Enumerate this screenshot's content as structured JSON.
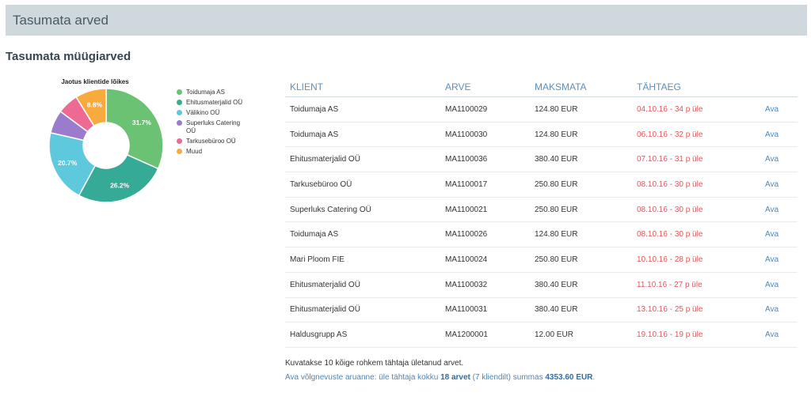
{
  "page": {
    "title": "Tasumata arved"
  },
  "section": {
    "title": "Tasumata müügiarved"
  },
  "chart_data": {
    "type": "pie",
    "title": "Jaotus klientide lõikes",
    "categories": [
      "Toidumaja AS",
      "Ehitusmaterjalid OÜ",
      "Välikino OÜ",
      "Superluks Catering OÜ",
      "Tarkusebüroo OÜ",
      "Muud"
    ],
    "values": [
      31.7,
      26.2,
      20.7,
      6.6,
      6.0,
      8.8
    ],
    "labels": [
      "31.7%",
      "26.2%",
      "20.7%",
      "",
      "",
      "8.8%"
    ],
    "colors": [
      "#6ac272",
      "#35ab97",
      "#5ec9dc",
      "#9b7ccc",
      "#ec6a93",
      "#f9aa3c"
    ],
    "legend_position": "right"
  },
  "table": {
    "headers": [
      "KLIENT",
      "ARVE",
      "MAKSMATA",
      "TÄHTAEG",
      ""
    ],
    "rows": [
      {
        "client": "Toidumaja AS",
        "invoice": "MA1100029",
        "amount": "124.80 EUR",
        "due": "04.10.16 - 34 p üle",
        "action": "Ava"
      },
      {
        "client": "Toidumaja AS",
        "invoice": "MA1100030",
        "amount": "124.80 EUR",
        "due": "06.10.16 - 32 p üle",
        "action": "Ava"
      },
      {
        "client": "Ehitusmaterjalid OÜ",
        "invoice": "MA1100036",
        "amount": "380.40 EUR",
        "due": "07.10.16 - 31 p üle",
        "action": "Ava"
      },
      {
        "client": "Tarkusebüroo OÜ",
        "invoice": "MA1100017",
        "amount": "250.80 EUR",
        "due": "08.10.16 - 30 p üle",
        "action": "Ava"
      },
      {
        "client": "Superluks Catering OÜ",
        "invoice": "MA1100021",
        "amount": "250.80 EUR",
        "due": "08.10.16 - 30 p üle",
        "action": "Ava"
      },
      {
        "client": "Toidumaja AS",
        "invoice": "MA1100026",
        "amount": "124.80 EUR",
        "due": "08.10.16 - 30 p üle",
        "action": "Ava"
      },
      {
        "client": "Mari Ploom FIE",
        "invoice": "MA1100024",
        "amount": "250.80 EUR",
        "due": "10.10.16 - 28 p üle",
        "action": "Ava"
      },
      {
        "client": "Ehitusmaterjalid OÜ",
        "invoice": "MA1100032",
        "amount": "380.40 EUR",
        "due": "11.10.16 - 27 p üle",
        "action": "Ava"
      },
      {
        "client": "Ehitusmaterjalid OÜ",
        "invoice": "MA1100031",
        "amount": "380.40 EUR",
        "due": "13.10.16 - 25 p üle",
        "action": "Ava"
      },
      {
        "client": "Haldusgrupp AS",
        "invoice": "MA1200001",
        "amount": "12.00 EUR",
        "due": "19.10.16 - 19 p üle",
        "action": "Ava"
      }
    ]
  },
  "footer": {
    "note": "Kuvatakse 10 kõige rohkem tähtaja ületanud arvet.",
    "report_prefix": "Ava võlgnevuste aruanne: üle tähtaja kokku ",
    "report_count": "18 arvet",
    "report_mid": " (7 kliendilt) summas ",
    "report_sum": "4353.60 EUR",
    "report_end": "."
  }
}
